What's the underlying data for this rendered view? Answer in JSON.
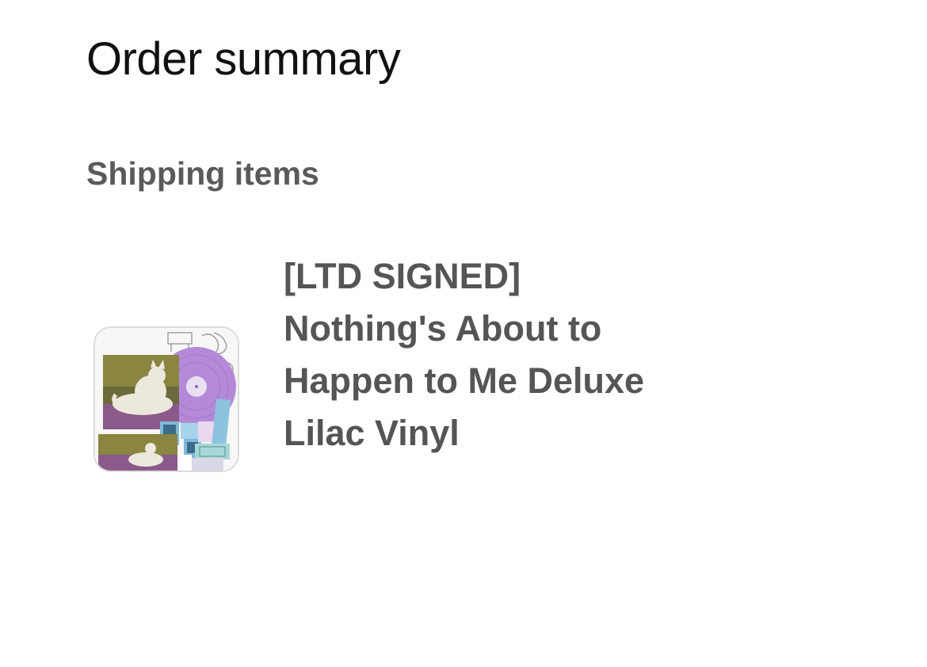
{
  "header": {
    "title": "Order summary"
  },
  "shipping": {
    "heading": "Shipping items",
    "items": [
      {
        "title": "[LTD SIGNED] Nothing's About to Happen to Me Deluxe Lilac Vinyl",
        "image": "album-cover-thumbnail"
      }
    ]
  },
  "colors": {
    "title_text": "#111111",
    "muted_text": "#5a5a5a",
    "vinyl_lilac": "#b48ad8"
  }
}
